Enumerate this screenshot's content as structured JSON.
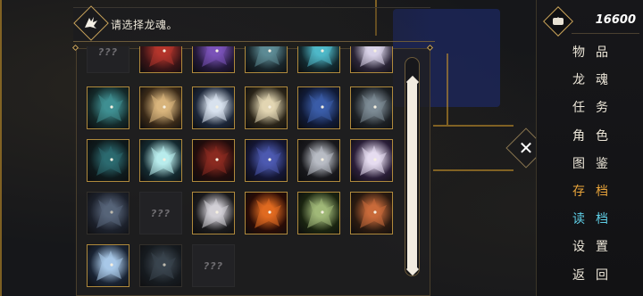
{
  "header": {
    "title": "请选择龙魂。"
  },
  "currency": {
    "icon": "coin-icon",
    "value": "16600"
  },
  "menu": [
    {
      "label": "物品",
      "id": "items"
    },
    {
      "label": "龙魂",
      "id": "dragon-soul"
    },
    {
      "label": "任务",
      "id": "quests"
    },
    {
      "label": "角色",
      "id": "characters"
    },
    {
      "label": "图鉴",
      "id": "codex"
    },
    {
      "label": "存档",
      "id": "save",
      "color": "#e8a43a"
    },
    {
      "label": "读档",
      "id": "load",
      "color": "#5fd0e8"
    },
    {
      "label": "设置",
      "id": "settings"
    },
    {
      "label": "返回",
      "id": "back"
    }
  ],
  "close_icon": "close-icon",
  "locked_text": "???",
  "grid": {
    "rows": [
      [
        "locked",
        "red",
        "purple",
        "teal-dark",
        "cyan",
        "white-purple"
      ],
      [
        "teal",
        "tan",
        "white-blue",
        "bone",
        "navy",
        "gray"
      ],
      [
        "dark-teal",
        "ice",
        "crimson",
        "violet",
        "silver",
        "lavender"
      ],
      [
        "frost-dim",
        "locked",
        "pale",
        "fire",
        "green",
        "amber"
      ],
      [
        "sky",
        "slate-dim",
        "locked"
      ]
    ]
  },
  "palette": {
    "red": [
      "#3a1416",
      "#b3352c"
    ],
    "purple": [
      "#221838",
      "#7a52b8"
    ],
    "teal-dark": [
      "#18252a",
      "#5c8a94"
    ],
    "cyan": [
      "#132a30",
      "#4fb8c8"
    ],
    "white-purple": [
      "#2a2436",
      "#d8d2e8"
    ],
    "teal": [
      "#142a2a",
      "#3f8f92"
    ],
    "tan": [
      "#3a2a18",
      "#d8b47c"
    ],
    "white-blue": [
      "#1c2638",
      "#d8e2ee"
    ],
    "bone": [
      "#2a2418",
      "#e2d6b2"
    ],
    "navy": [
      "#101a36",
      "#3a5ca8"
    ],
    "gray": [
      "#1c2024",
      "#7c8a94"
    ],
    "dark-teal": [
      "#0e1a1c",
      "#2c6a70"
    ],
    "ice": [
      "#142a30",
      "#b8ecec"
    ],
    "crimson": [
      "#220c0c",
      "#8a2a20"
    ],
    "violet": [
      "#141634",
      "#4c5ab0"
    ],
    "silver": [
      "#18181c",
      "#b8bcc4"
    ],
    "lavender": [
      "#2a1e38",
      "#e6dcf0"
    ],
    "frost-dim": [
      "#1c2230",
      "#6a7c98"
    ],
    "pale": [
      "#1a1a1c",
      "#d2cfd6"
    ],
    "fire": [
      "#2a0c06",
      "#e06a20"
    ],
    "green": [
      "#1a2410",
      "#a0b878"
    ],
    "amber": [
      "#2a1a10",
      "#c86a3a"
    ],
    "sky": [
      "#1a2434",
      "#a8c8e8"
    ],
    "slate-dim": [
      "#141a20",
      "#44525e"
    ]
  }
}
